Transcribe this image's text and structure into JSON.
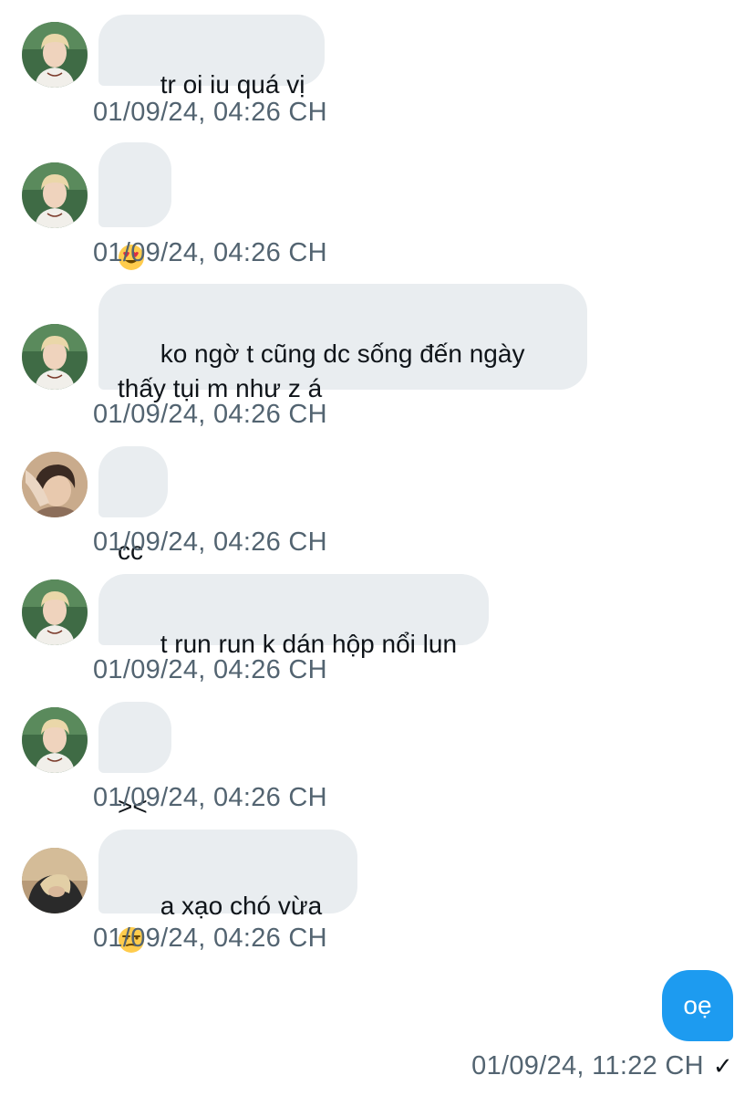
{
  "messages": [
    {
      "text": "tr oi iu quá vị",
      "time": "01/09/24, 04:26 CH",
      "avatar": "blond-user-avatar"
    },
    {
      "text": "",
      "emoji": "heart-eyes-emoji",
      "time": "01/09/24, 04:26 CH",
      "avatar": "blond-user-avatar"
    },
    {
      "text": "ko ngờ t cũng dc sống đến ngày\nthấy tụi m như z á",
      "time": "01/09/24, 04:26 CH",
      "avatar": "blond-user-avatar"
    },
    {
      "text": "cc",
      "time": "01/09/24, 04:26 CH",
      "avatar": "dark-hair-user-avatar"
    },
    {
      "text": "t run run k dán hộp nổi lun",
      "time": "01/09/24, 04:26 CH",
      "avatar": "blond-user-avatar"
    },
    {
      "text": "><",
      "time": "01/09/24, 04:26 CH",
      "avatar": "blond-user-avatar"
    },
    {
      "text": "a xạo chó vừa",
      "emoji": "unamused-face-emoji",
      "time": "01/09/24, 04:26 CH",
      "avatar": "hooded-user-avatar"
    }
  ],
  "outgoing": {
    "text": "oẹ",
    "time": "01/09/24, 11:22 CH",
    "status_icon": "checkmark-icon",
    "status_glyph": "✓"
  },
  "colors": {
    "incoming_bubble": "#e9edf0",
    "outgoing_bubble": "#1d9bf0",
    "timestamp": "#536471"
  }
}
